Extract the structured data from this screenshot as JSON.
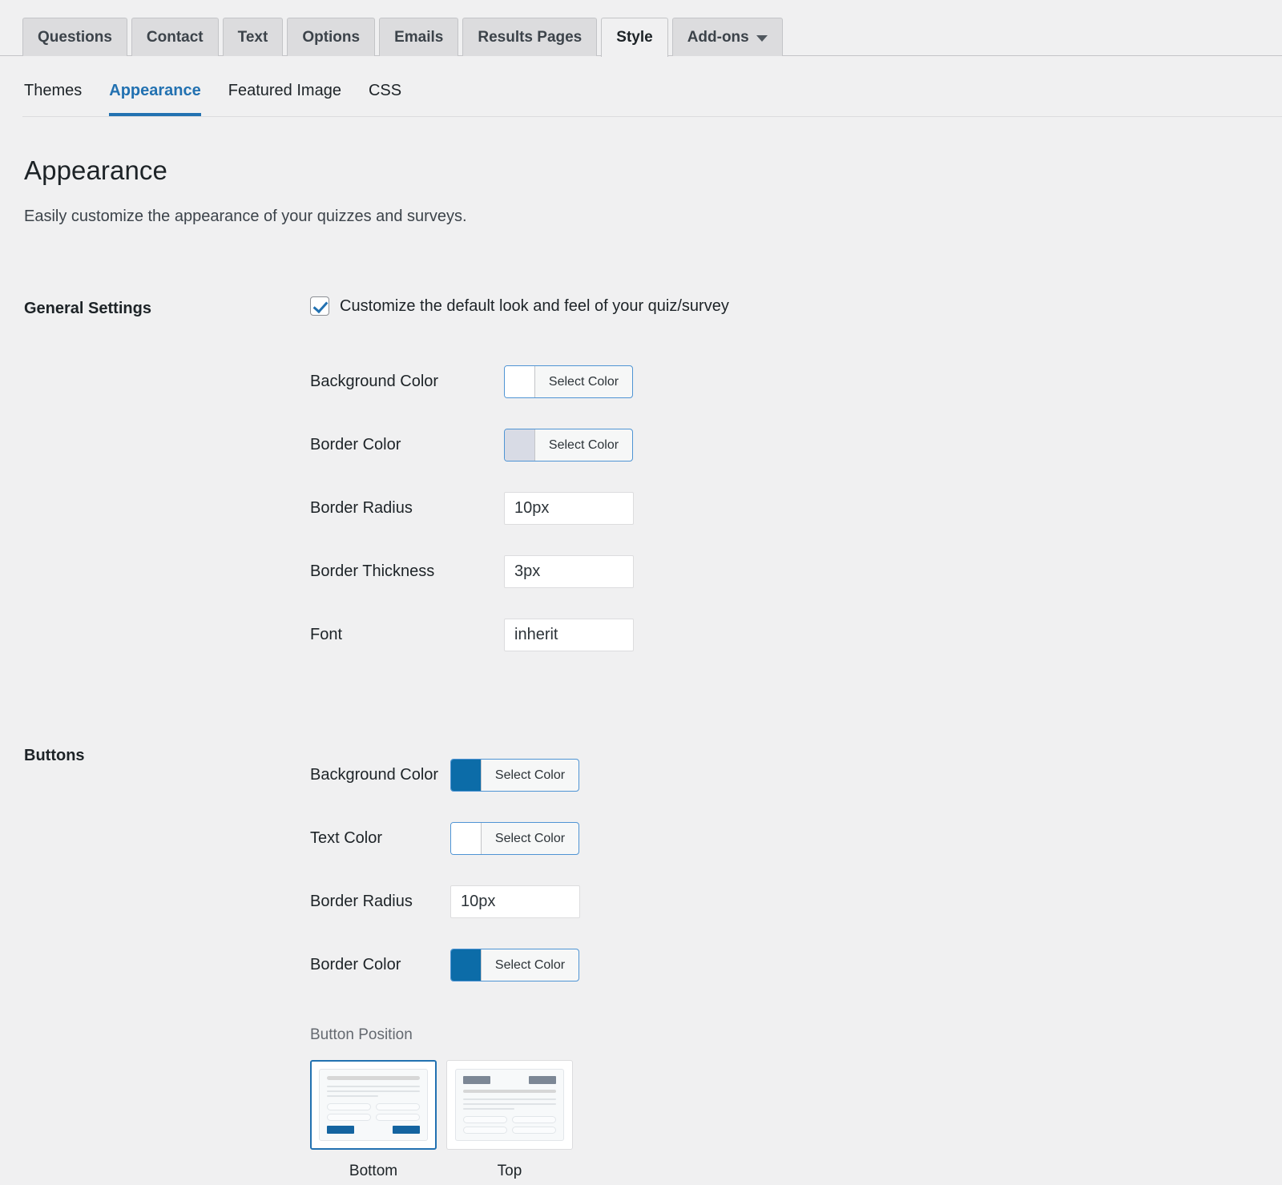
{
  "top_tabs": [
    {
      "label": "Questions",
      "active": false
    },
    {
      "label": "Contact",
      "active": false
    },
    {
      "label": "Text",
      "active": false
    },
    {
      "label": "Options",
      "active": false
    },
    {
      "label": "Emails",
      "active": false
    },
    {
      "label": "Results Pages",
      "active": false
    },
    {
      "label": "Style",
      "active": true
    },
    {
      "label": "Add-ons",
      "active": false,
      "has_caret": true
    }
  ],
  "sub_nav": [
    {
      "label": "Themes",
      "active": false
    },
    {
      "label": "Appearance",
      "active": true
    },
    {
      "label": "Featured Image",
      "active": false
    },
    {
      "label": "CSS",
      "active": false
    }
  ],
  "header": {
    "title": "Appearance",
    "subtitle": "Easily customize the appearance of your quizzes and surveys."
  },
  "general": {
    "section_title": "General Settings",
    "customize_checkbox_label": "Customize the default look and feel of your quiz/survey",
    "customize_checked": true,
    "fields": [
      {
        "label": "Background Color",
        "type": "color",
        "button_label": "Select Color",
        "swatch": "#ffffff"
      },
      {
        "label": "Border Color",
        "type": "color",
        "button_label": "Select Color",
        "swatch": "#d8dbe5"
      },
      {
        "label": "Border Radius",
        "type": "text",
        "value": "10px"
      },
      {
        "label": "Border Thickness",
        "type": "text",
        "value": "3px"
      },
      {
        "label": "Font",
        "type": "text",
        "value": "inherit"
      }
    ]
  },
  "buttons": {
    "section_title": "Buttons",
    "fields": [
      {
        "label": "Background Color",
        "type": "color",
        "button_label": "Select Color",
        "swatch": "#0c6ca8"
      },
      {
        "label": "Text Color",
        "type": "color",
        "button_label": "Select Color",
        "swatch": "#ffffff"
      },
      {
        "label": "Border Radius",
        "type": "text",
        "value": "10px"
      },
      {
        "label": "Border Color",
        "type": "color",
        "button_label": "Select Color",
        "swatch": "#0c6ca8"
      }
    ],
    "button_position": {
      "label": "Button Position",
      "options": [
        {
          "caption": "Bottom",
          "selected": true
        },
        {
          "caption": "Top",
          "selected": false
        }
      ]
    }
  },
  "colors": {
    "accent": "#2271b1",
    "brand_blue": "#0c6ca8",
    "page_bg": "#f0f0f1",
    "tab_bg": "#dcdcde"
  }
}
